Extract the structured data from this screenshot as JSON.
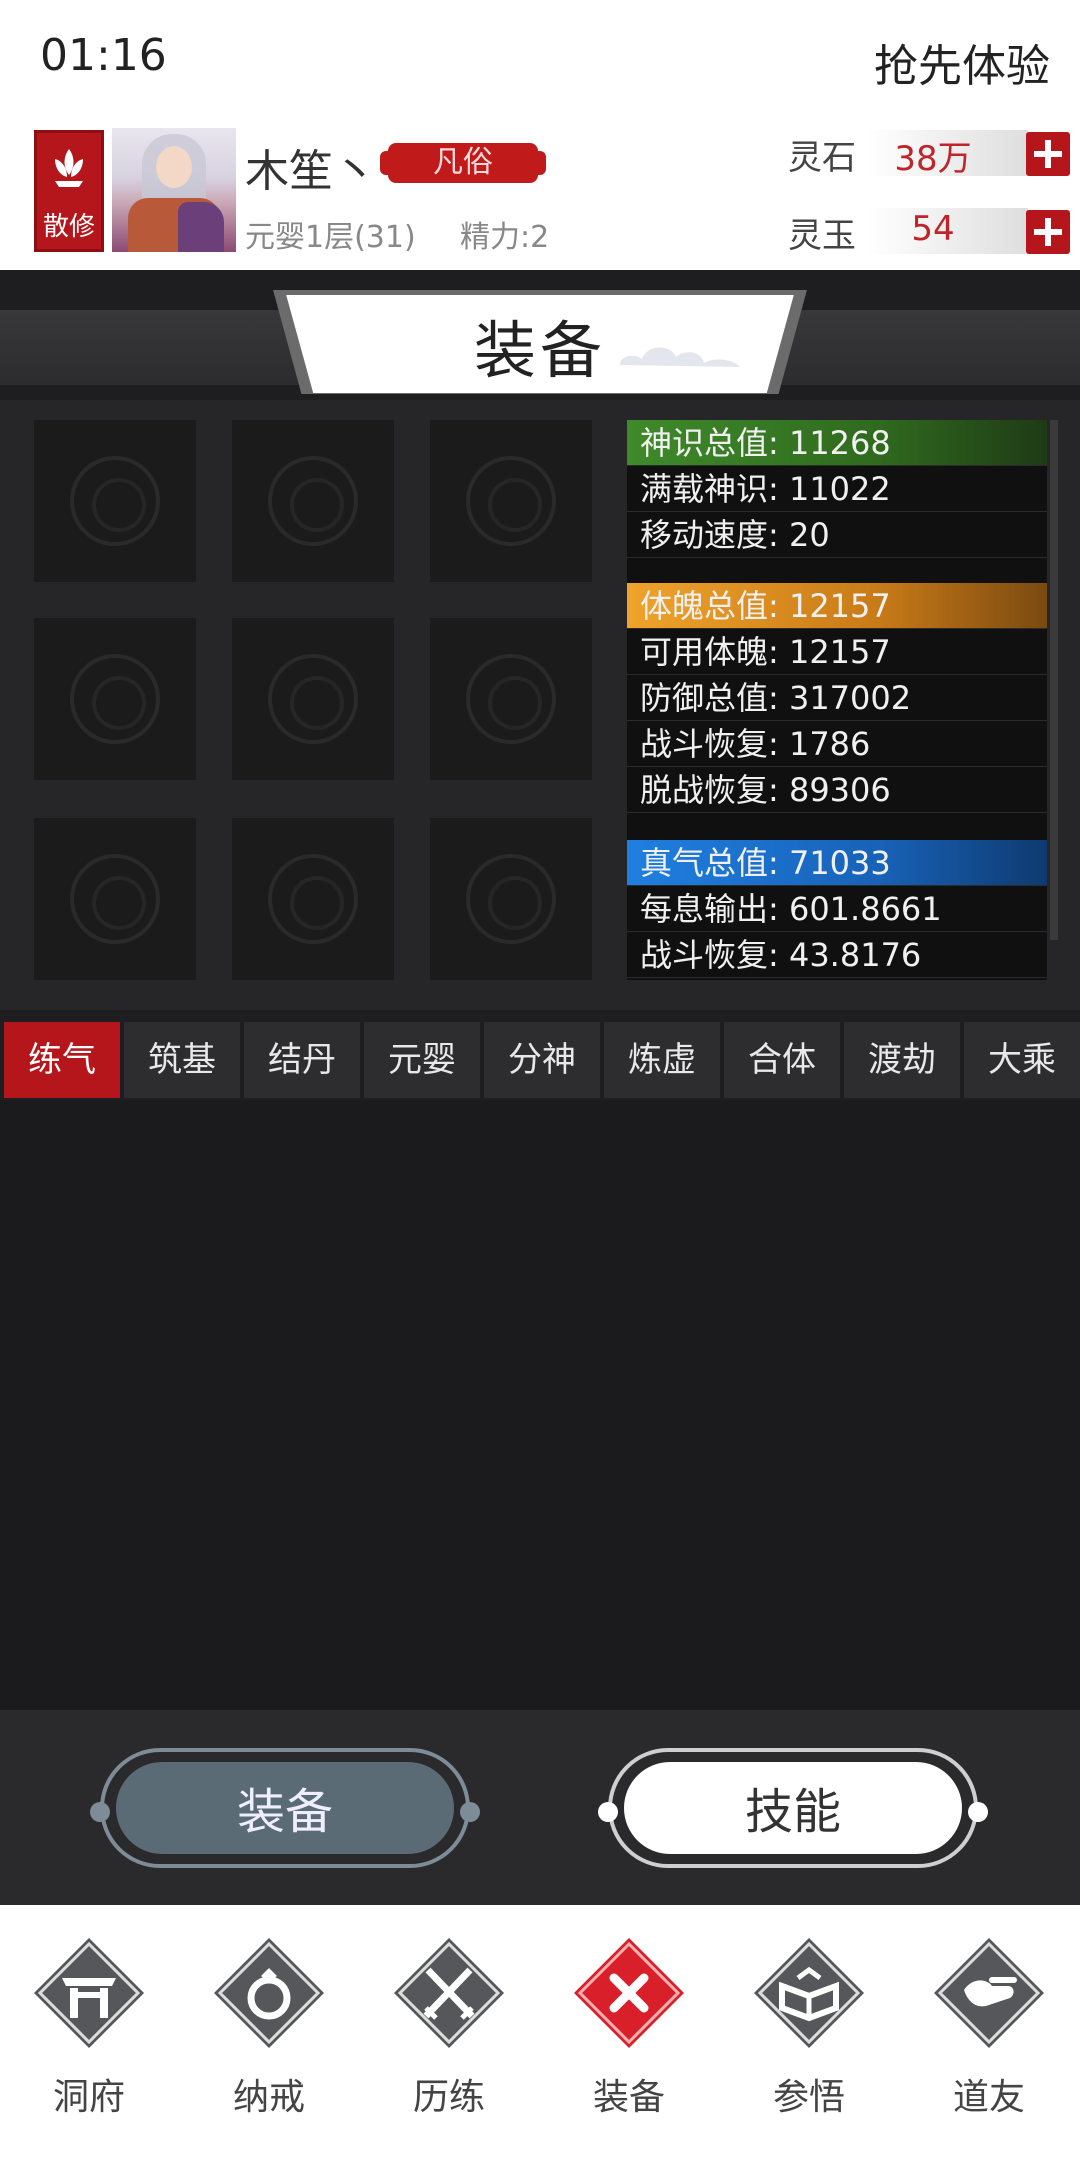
{
  "status": {
    "time": "01:16",
    "early_access": "抢先体验"
  },
  "player": {
    "sect_badge": "散修",
    "name": "木笙丶",
    "rank_tag": "凡俗",
    "realm": "元婴1层(31)",
    "energy": "精力:2"
  },
  "currency": {
    "stone_label": "灵石",
    "stone_value": "38万",
    "jade_label": "灵玉",
    "jade_value": "54"
  },
  "panel": {
    "title": "装备"
  },
  "stats": [
    {
      "text": "神识总值: 11268",
      "style": "head-green"
    },
    {
      "text": "满载神识: 11022",
      "style": ""
    },
    {
      "text": "移动速度: 20",
      "style": ""
    },
    {
      "text": "体魄总值: 12157",
      "style": "head-orange"
    },
    {
      "text": "可用体魄: 12157",
      "style": ""
    },
    {
      "text": "防御总值: 317002",
      "style": ""
    },
    {
      "text": "战斗恢复: 1786",
      "style": ""
    },
    {
      "text": "脱战恢复: 89306",
      "style": ""
    },
    {
      "text": "真气总值: 71033",
      "style": "head-blue"
    },
    {
      "text": "每息输出: 601.8661",
      "style": ""
    },
    {
      "text": "战斗恢复: 43.8176",
      "style": ""
    }
  ],
  "tabs": [
    "练气",
    "筑基",
    "结丹",
    "元婴",
    "分神",
    "炼虚",
    "合体",
    "渡劫",
    "大乘"
  ],
  "active_tab": "练气",
  "switch": {
    "equip": "装备",
    "skill": "技能"
  },
  "nav": [
    {
      "label": "洞府",
      "icon": "cave-gate-icon"
    },
    {
      "label": "纳戒",
      "icon": "ring-icon"
    },
    {
      "label": "历练",
      "icon": "crossed-swords-icon"
    },
    {
      "label": "装备",
      "icon": "close-icon"
    },
    {
      "label": "参悟",
      "icon": "open-book-icon"
    },
    {
      "label": "道友",
      "icon": "handshake-icon"
    }
  ],
  "colors": {
    "accent_red": "#b5161b",
    "green": "#3f8a2a",
    "orange": "#f0a32a",
    "blue": "#1f7fe0"
  }
}
